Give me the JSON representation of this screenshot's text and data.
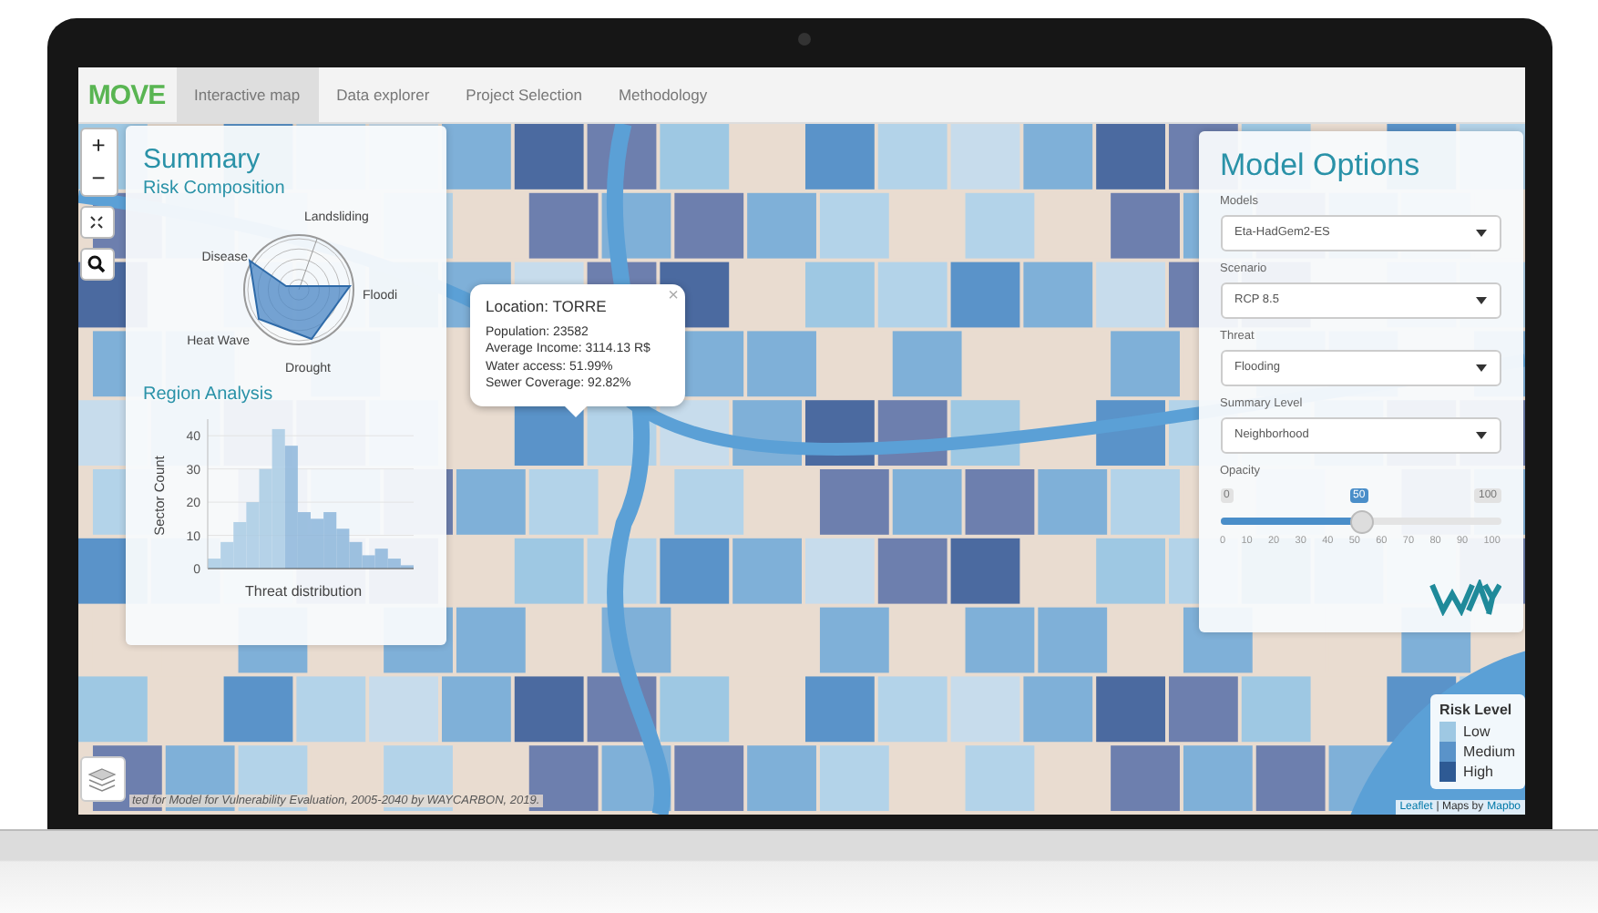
{
  "navbar": {
    "logo": "MOVE",
    "tabs": [
      {
        "label": "Interactive map",
        "selected": true
      },
      {
        "label": "Data explorer",
        "selected": false
      },
      {
        "label": "Project Selection",
        "selected": false
      },
      {
        "label": "Methodology",
        "selected": false
      }
    ]
  },
  "map_controls": {
    "zoom_in": "+",
    "zoom_out": "−"
  },
  "summary": {
    "title": "Summary",
    "risk_heading": "Risk Composition",
    "radar_labels": [
      "Landsliding",
      "Disease",
      "Floodi",
      "Heat Wave",
      "Drought"
    ],
    "region_heading": "Region Analysis",
    "chart_data": {
      "type": "bar",
      "xlabel": "Threat distribution",
      "ylabel": "Sector Count",
      "grid": true,
      "ylim": [
        0,
        45
      ],
      "yticks": [
        0,
        10,
        20,
        30,
        40
      ],
      "values": [
        3,
        8,
        14,
        20,
        30,
        42,
        37,
        17,
        15,
        17,
        12,
        8,
        4,
        6,
        3,
        1
      ]
    }
  },
  "popup": {
    "title": "Location: TORRE",
    "close": "×",
    "lines": [
      "Population: 23582",
      "Average Income: 3114.13 R$",
      "Water access: 51.99%",
      "Sewer Coverage: 92.82%"
    ]
  },
  "model_options": {
    "title": "Model Options",
    "selects": [
      {
        "label": "Models",
        "value": "Eta-HadGem2-ES"
      },
      {
        "label": "Scenario",
        "value": "RCP 8.5"
      },
      {
        "label": "Threat",
        "value": "Flooding"
      },
      {
        "label": "Summary Level",
        "value": "Neighborhood"
      }
    ],
    "opacity": {
      "label": "Opacity",
      "min": "0",
      "max": "100",
      "value": "50",
      "level": 0.5,
      "ticks": [
        "0",
        "10",
        "20",
        "30",
        "40",
        "50",
        "60",
        "70",
        "80",
        "90",
        "100"
      ]
    }
  },
  "legend": {
    "title": "Risk Level",
    "items": [
      {
        "label": "Low",
        "color": "#9ec8e3"
      },
      {
        "label": "Medium",
        "color": "#5a93c9"
      },
      {
        "label": "High",
        "color": "#2e5a94"
      }
    ]
  },
  "attribution": "ted for Model for Vulnerability Evaluation, 2005-2040 by WAYCARBON, 2019.",
  "map_credit": {
    "link": "Leaflet",
    "text": "| Maps by",
    "provider": "Mapbo"
  }
}
